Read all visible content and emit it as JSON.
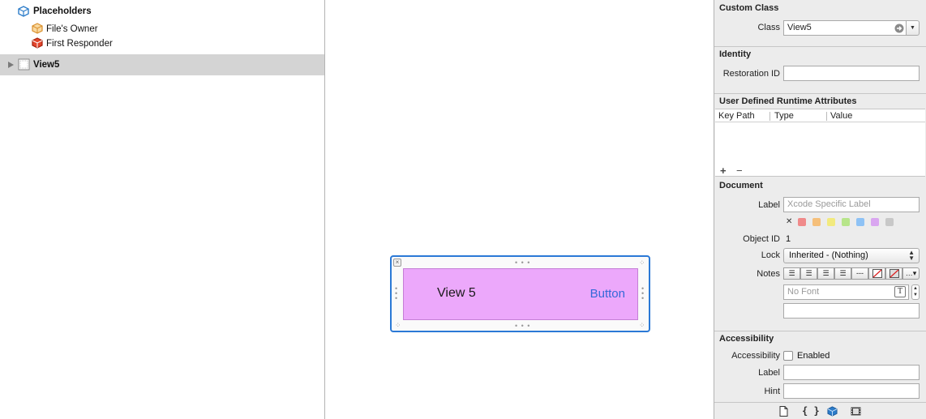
{
  "outline": {
    "placeholders_label": "Placeholders",
    "files_owner_label": "File's Owner",
    "first_responder_label": "First Responder",
    "view_label": "View5"
  },
  "canvas": {
    "view_title": "View 5",
    "button_label": "Button",
    "fill_color": "#eca8fb",
    "selection_color": "#2b79d6"
  },
  "inspector": {
    "custom_class": {
      "title": "Custom Class",
      "class_label": "Class",
      "class_value": "View5"
    },
    "identity": {
      "title": "Identity",
      "restoration_id_label": "Restoration ID",
      "restoration_id_value": ""
    },
    "runtime_attributes": {
      "title": "User Defined Runtime Attributes",
      "columns": [
        "Key Path",
        "Type",
        "Value"
      ],
      "add_label": "+",
      "remove_label": "−"
    },
    "document": {
      "title": "Document",
      "label_label": "Label",
      "label_placeholder": "Xcode Specific Label",
      "clear_label": "✕",
      "swatch_colors": [
        "#f08a8a",
        "#f5bf7a",
        "#f2ea7e",
        "#b7e58a",
        "#8ec2f5",
        "#d9a6f0",
        "#c8c8c8"
      ],
      "object_id_label": "Object ID",
      "object_id_value": "1",
      "lock_label": "Lock",
      "lock_value": "Inherited - (Nothing)",
      "notes_label": "Notes",
      "font_placeholder": "No Font"
    },
    "accessibility": {
      "title": "Accessibility",
      "accessibility_label": "Accessibility",
      "enabled_label": "Enabled",
      "label_label": "Label",
      "hint_label": "Hint"
    }
  }
}
